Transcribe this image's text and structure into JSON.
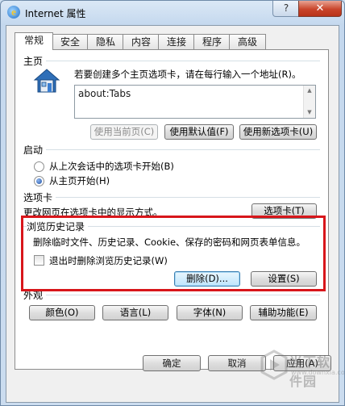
{
  "window": {
    "title": "Internet 属性",
    "help": "?",
    "close": "✕"
  },
  "tabs": [
    "常规",
    "安全",
    "隐私",
    "内容",
    "连接",
    "程序",
    "高级"
  ],
  "homepage": {
    "group_title": "主页",
    "instruction": "若要创建多个主页选项卡，请在每行输入一个地址(R)。",
    "value": "about:Tabs",
    "btn_current": "使用当前页(C)",
    "btn_default": "使用默认值(F)",
    "btn_new_tab": "使用新选项卡(U)"
  },
  "startup": {
    "group_title": "启动",
    "option_last_session": "从上次会话中的选项卡开始(B)",
    "option_homepage": "从主页开始(H)"
  },
  "tabs_section": {
    "group_title": "选项卡",
    "description": "更改网页在选项卡中的显示方式。",
    "btn_tabs": "选项卡(T)"
  },
  "history": {
    "group_title": "浏览历史记录",
    "description": "删除临时文件、历史记录、Cookie、保存的密码和网页表单信息。",
    "checkbox_label": "退出时删除浏览历史记录(W)",
    "btn_delete": "删除(D)...",
    "btn_settings": "设置(S)"
  },
  "appearance": {
    "group_title": "外观",
    "btn_colors": "颜色(O)",
    "btn_languages": "语言(L)",
    "btn_fonts": "字体(N)",
    "btn_accessibility": "辅助功能(E)"
  },
  "footer": {
    "ok": "确定",
    "cancel": "取消",
    "apply": "应用(A)"
  },
  "watermark": {
    "text": "当下软件园",
    "url": "www.downxia.com"
  },
  "colors": {
    "highlight": "#d8161b",
    "accent": "#3c7fb1"
  }
}
